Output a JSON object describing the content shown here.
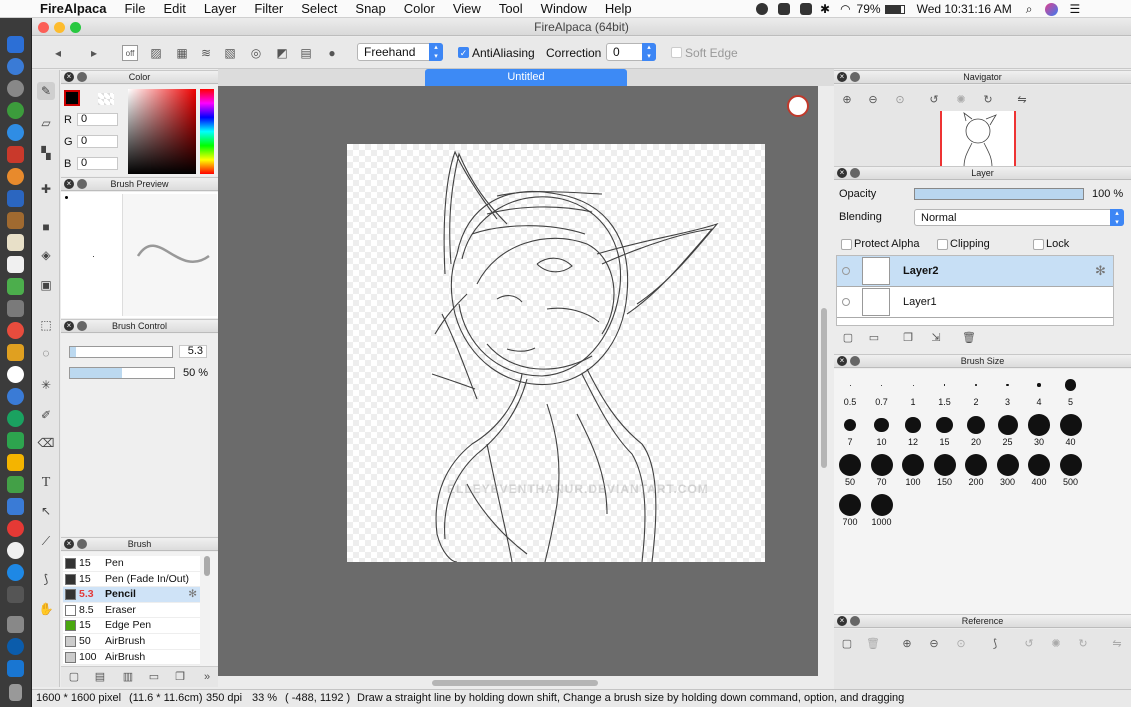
{
  "menubar": {
    "app": "FireAlpaca",
    "items": [
      "File",
      "Edit",
      "Layer",
      "Filter",
      "Select",
      "Snap",
      "Color",
      "View",
      "Tool",
      "Window",
      "Help"
    ],
    "battery": "79%",
    "clock": "Wed 10:31:16 AM"
  },
  "window": {
    "title": "FireAlpaca (64bit)"
  },
  "toolbar": {
    "stroke_mode": "Freehand",
    "antialias_label": "AntiAliasing",
    "correction_label": "Correction",
    "correction_value": "0",
    "soft_edge_label": "Soft Edge"
  },
  "color_panel": {
    "title": "Color",
    "r_label": "R",
    "r_value": "0",
    "g_label": "G",
    "g_value": "0",
    "b_label": "B",
    "b_value": "0"
  },
  "brush_preview": {
    "title": "Brush Preview"
  },
  "brush_control": {
    "title": "Brush Control",
    "size_value": "5.3",
    "opacity_value": "50 %",
    "size_fraction": 0.053,
    "opacity_fraction": 0.5
  },
  "brush_panel": {
    "title": "Brush",
    "items": [
      {
        "size": "15",
        "name": "Pen",
        "color": "#333333"
      },
      {
        "size": "15",
        "name": "Pen (Fade In/Out)",
        "color": "#333333"
      },
      {
        "size": "5.3",
        "name": "Pencil",
        "color": "#333333",
        "selected": true
      },
      {
        "size": "8.5",
        "name": "Eraser",
        "color": "#ffffff"
      },
      {
        "size": "15",
        "name": "Edge Pen",
        "color": "#4aa70f"
      },
      {
        "size": "50",
        "name": "AirBrush",
        "color": "#cccccc"
      },
      {
        "size": "100",
        "name": "AirBrush",
        "color": "#cccccc"
      }
    ]
  },
  "canvas": {
    "tab": "Untitled",
    "watermark": "ELLEYEVENTHANUR.DEVIANTART.COM"
  },
  "navigator": {
    "title": "Navigator"
  },
  "layer_panel": {
    "title": "Layer",
    "opacity_label": "Opacity",
    "opacity_value": "100 %",
    "opacity_fraction": 1.0,
    "blending_label": "Blending",
    "blending_value": "Normal",
    "protect_alpha": "Protect Alpha",
    "clipping": "Clipping",
    "lock": "Lock",
    "layers": [
      {
        "name": "Layer2",
        "selected": true
      },
      {
        "name": "Layer1",
        "selected": false
      }
    ]
  },
  "brush_size": {
    "title": "Brush Size",
    "sizes": [
      "0.5",
      "0.7",
      "1",
      "1.5",
      "2",
      "3",
      "4",
      "5",
      "7",
      "10",
      "12",
      "15",
      "20",
      "25",
      "30",
      "40",
      "50",
      "70",
      "100",
      "150",
      "200",
      "300",
      "400",
      "500",
      "700",
      "1000"
    ]
  },
  "reference": {
    "title": "Reference"
  },
  "status": {
    "dimensions": "1600 * 1600 pixel",
    "physical": "(11.6 * 11.6cm)",
    "dpi": "350 dpi",
    "zoom": "33 %",
    "coords": "( -488, 1192 )",
    "hint": "Draw a straight line by holding down shift, Change a brush size by holding down command, option, and dragging"
  }
}
